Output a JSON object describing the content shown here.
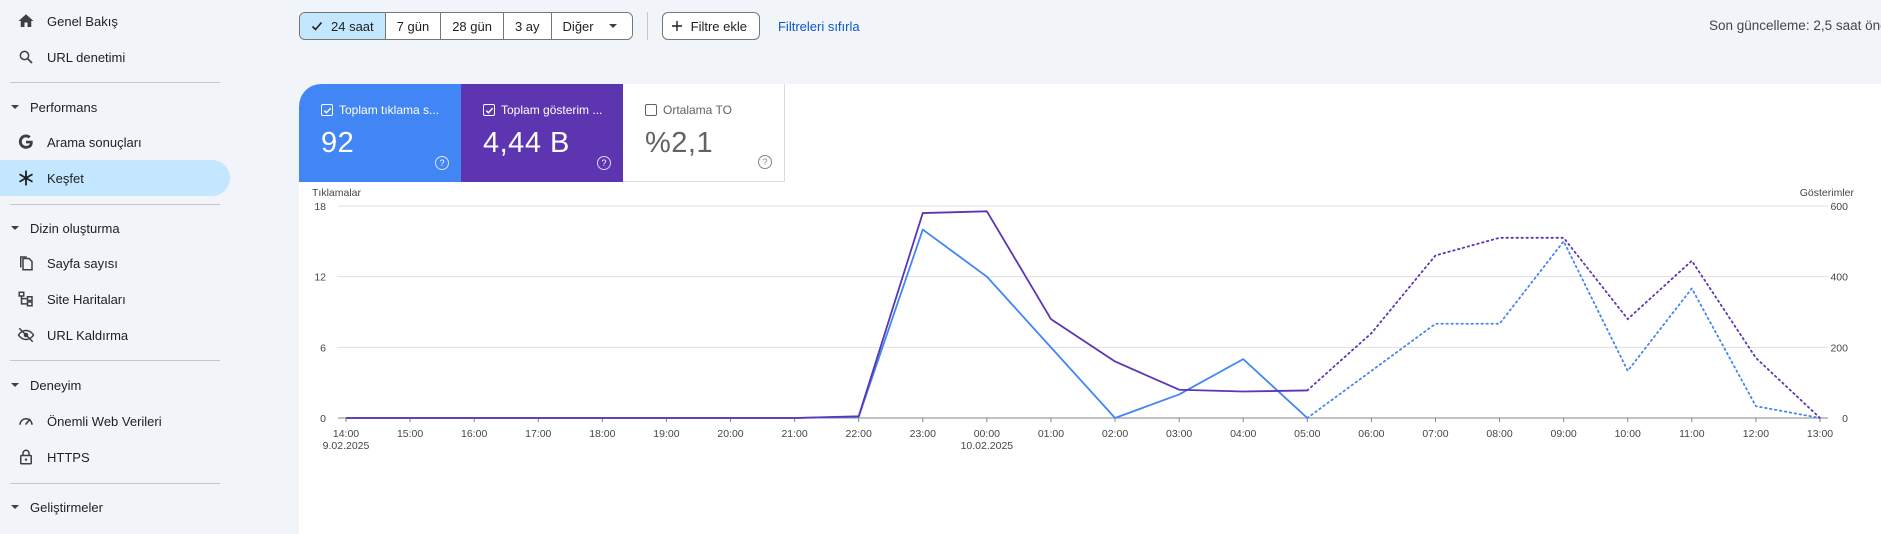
{
  "sidebar": {
    "overview": {
      "label": "Genel Bakış",
      "icon": "home-icon"
    },
    "url_inspection": {
      "label": "URL denetimi",
      "icon": "search-icon"
    },
    "performance": {
      "title": "Performans",
      "items": [
        {
          "label": "Arama sonuçları",
          "icon": "google-g-icon"
        },
        {
          "label": "Keşfet",
          "icon": "asterisk-icon",
          "active": true
        }
      ]
    },
    "indexing": {
      "title": "Dizin oluşturma",
      "items": [
        {
          "label": "Sayfa sayısı",
          "icon": "pages-icon"
        },
        {
          "label": "Site Haritaları",
          "icon": "sitemap-icon"
        },
        {
          "label": "URL Kaldırma",
          "icon": "eye-off-icon"
        }
      ]
    },
    "experience": {
      "title": "Deneyim",
      "items": [
        {
          "label": "Önemli Web Verileri",
          "icon": "speedometer-icon"
        },
        {
          "label": "HTTPS",
          "icon": "lock-icon"
        }
      ]
    },
    "enhancements": {
      "title": "Geliştirmeler"
    }
  },
  "toolbar": {
    "ranges": [
      "24 saat",
      "7 gün",
      "28 gün",
      "3 ay"
    ],
    "selected_range": "24 saat",
    "more_label": "Diğer",
    "add_filter": "Filtre ekle",
    "reset_filters": "Filtreleri sıfırla",
    "last_update": "Son güncelleme: 2,5 saat önce"
  },
  "metrics": {
    "clicks": {
      "label": "Toplam tıklama s...",
      "value": "92",
      "checked": true,
      "color": "#4285f4"
    },
    "impressions": {
      "label": "Toplam gösterim ...",
      "value": "4,44 B",
      "checked": true,
      "color": "#5e35b1"
    },
    "ctr": {
      "label": "Ortalama TO",
      "value": "%2,1",
      "checked": false
    }
  },
  "chart_data": {
    "type": "line",
    "left_axis_label": "Tıklamalar",
    "right_axis_label": "Gösterimler",
    "left_ylim": [
      0,
      18
    ],
    "left_ticks": [
      "0",
      "6",
      "12",
      "18"
    ],
    "right_ylim": [
      0,
      600
    ],
    "right_ticks": [
      "0",
      "200",
      "400",
      "600"
    ],
    "x": [
      "14:00",
      "15:00",
      "16:00",
      "17:00",
      "18:00",
      "19:00",
      "20:00",
      "21:00",
      "22:00",
      "23:00",
      "00:00",
      "01:00",
      "02:00",
      "03:00",
      "04:00",
      "05:00",
      "06:00",
      "07:00",
      "08:00",
      "09:00",
      "10:00",
      "11:00",
      "12:00",
      "13:00"
    ],
    "x_sublabels": {
      "0": "9.02.2025",
      "10": "10.02.2025"
    },
    "grid": true,
    "series": [
      {
        "name": "Toplam tıklama sayısı",
        "axis": "left",
        "color": "#4285f4",
        "values": [
          0,
          0,
          0,
          0,
          0,
          0,
          0,
          0,
          0.1,
          16,
          12,
          6,
          0,
          2,
          5,
          0,
          null,
          null,
          null,
          null,
          null,
          null,
          null,
          null
        ],
        "projected_values": [
          null,
          null,
          null,
          null,
          null,
          null,
          null,
          null,
          null,
          null,
          null,
          null,
          null,
          null,
          null,
          0,
          4,
          8,
          8,
          15,
          4,
          11,
          1,
          0
        ]
      },
      {
        "name": "Toplam gösterim",
        "axis": "right",
        "color": "#5e35b1",
        "values": [
          0,
          0,
          0,
          0,
          0,
          0,
          0,
          0,
          5,
          580,
          585,
          280,
          160,
          80,
          75,
          78,
          null,
          null,
          null,
          null,
          null,
          null,
          null,
          null
        ],
        "projected_values": [
          null,
          null,
          null,
          null,
          null,
          null,
          null,
          null,
          null,
          null,
          null,
          null,
          null,
          null,
          null,
          78,
          240,
          460,
          510,
          510,
          280,
          445,
          170,
          0
        ]
      }
    ]
  }
}
